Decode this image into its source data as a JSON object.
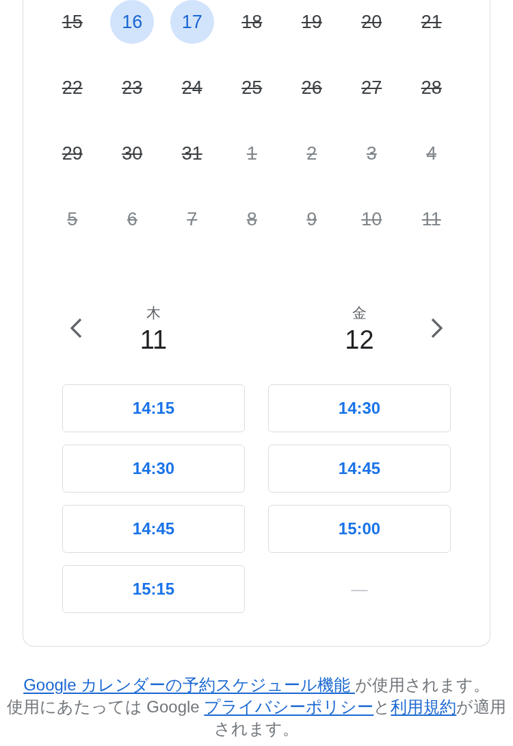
{
  "calendar": {
    "weeks": [
      {
        "days": [
          {
            "label": "15",
            "available": false,
            "in_month": true
          },
          {
            "label": "16",
            "available": true,
            "in_month": true
          },
          {
            "label": "17",
            "available": true,
            "in_month": true
          },
          {
            "label": "18",
            "available": false,
            "in_month": true
          },
          {
            "label": "19",
            "available": false,
            "in_month": true
          },
          {
            "label": "20",
            "available": false,
            "in_month": true
          },
          {
            "label": "21",
            "available": false,
            "in_month": true
          }
        ]
      },
      {
        "days": [
          {
            "label": "22",
            "available": false,
            "in_month": true
          },
          {
            "label": "23",
            "available": false,
            "in_month": true
          },
          {
            "label": "24",
            "available": false,
            "in_month": true
          },
          {
            "label": "25",
            "available": false,
            "in_month": true
          },
          {
            "label": "26",
            "available": false,
            "in_month": true
          },
          {
            "label": "27",
            "available": false,
            "in_month": true
          },
          {
            "label": "28",
            "available": false,
            "in_month": true
          }
        ]
      },
      {
        "days": [
          {
            "label": "29",
            "available": false,
            "in_month": true
          },
          {
            "label": "30",
            "available": false,
            "in_month": true
          },
          {
            "label": "31",
            "available": false,
            "in_month": true
          },
          {
            "label": "1",
            "available": false,
            "in_month": false
          },
          {
            "label": "2",
            "available": false,
            "in_month": false
          },
          {
            "label": "3",
            "available": false,
            "in_month": false
          },
          {
            "label": "4",
            "available": false,
            "in_month": false
          }
        ]
      },
      {
        "days": [
          {
            "label": "5",
            "available": false,
            "in_month": false
          },
          {
            "label": "6",
            "available": false,
            "in_month": false
          },
          {
            "label": "7",
            "available": false,
            "in_month": false
          },
          {
            "label": "8",
            "available": false,
            "in_month": false
          },
          {
            "label": "9",
            "available": false,
            "in_month": false
          },
          {
            "label": "10",
            "available": false,
            "in_month": false
          },
          {
            "label": "11",
            "available": false,
            "in_month": false
          }
        ]
      }
    ]
  },
  "day_picker": {
    "days": [
      {
        "weekday": "木",
        "date": "11",
        "slots": [
          "14:15",
          "14:30",
          "14:45",
          "15:15"
        ]
      },
      {
        "weekday": "金",
        "date": "12",
        "slots": [
          "14:30",
          "14:45",
          "15:00"
        ],
        "empty_marker": "—"
      }
    ]
  },
  "footer": {
    "paragraphs": [
      [
        {
          "kind": "link",
          "text": "Google カレンダーの予約スケジュール機能 "
        },
        {
          "kind": "text",
          "text": "が使用されます。"
        }
      ],
      [
        {
          "kind": "text",
          "text": "使用にあたっては Google "
        },
        {
          "kind": "link",
          "text": "プライバシーポリシー"
        },
        {
          "kind": "text",
          "text": "と"
        },
        {
          "kind": "link",
          "text": "利用規約"
        },
        {
          "kind": "text",
          "text": "が適用されます。"
        }
      ]
    ]
  }
}
